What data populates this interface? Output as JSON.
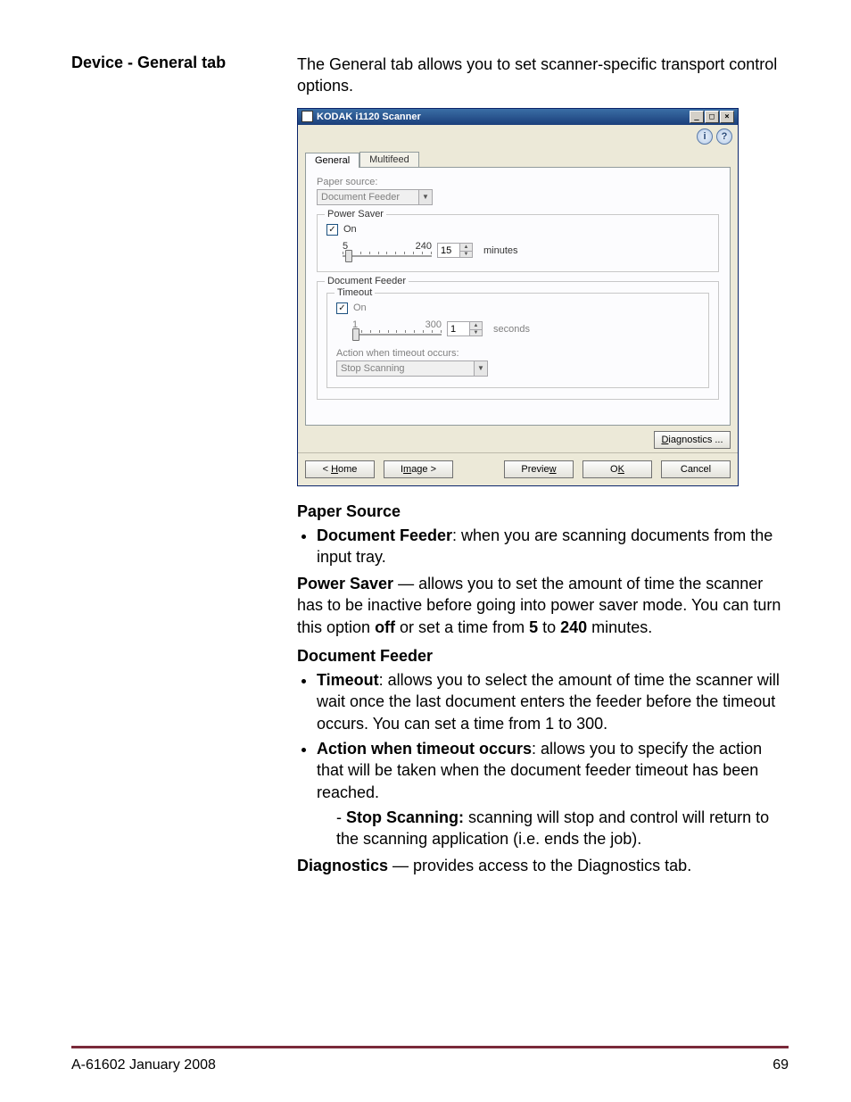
{
  "heading": "Device - General tab",
  "intro": "The General tab allows you to set scanner-specific transport control options.",
  "window": {
    "title": "KODAK i1120 Scanner",
    "tabs": {
      "general": "General",
      "multifeed": "Multifeed"
    },
    "paper_source": {
      "label": "Paper source:",
      "value": "Document Feeder"
    },
    "power_saver": {
      "group": "Power Saver",
      "on": "On",
      "min": "5",
      "max": "240",
      "value": "15",
      "unit": "minutes"
    },
    "doc_feeder": {
      "group": "Document Feeder",
      "timeout_group": "Timeout",
      "on": "On",
      "min": "1",
      "max": "300",
      "value": "1",
      "unit": "seconds",
      "action_label": "Action when timeout occurs:",
      "action_value": "Stop Scanning"
    },
    "buttons": {
      "diagnostics": "Diagnostics ...",
      "home": "< Home",
      "image": "Image >",
      "preview": "Preview",
      "ok": "OK",
      "cancel": "Cancel"
    }
  },
  "body": {
    "paper_source_h": "Paper Source",
    "doc_feed_bullet_label": "Document Feeder",
    "doc_feed_bullet_text": ": when you are scanning documents from the input tray.",
    "power_h": "Power Saver",
    "power_text_a": " — allows you to set the amount of time the scanner has to be inactive before going into power saver mode. You can turn this option ",
    "off": "off",
    "power_text_b": " or set a time from ",
    "five": "5",
    "to": " to ",
    "max": "240",
    "power_text_c": " minutes.",
    "doc_feed_h": "Document Feeder",
    "timeout_label": "Timeout",
    "timeout_text": ": allows you to select the amount of time the scanner will wait once the last document enters the feeder before the timeout occurs. You can set a time from 1 to 300.",
    "action_label": "Action when timeout occurs",
    "action_text": ": allows you to specify the action that will be taken when the document feeder timeout has been reached.",
    "stop_label": "Stop Scanning:",
    "stop_text": " scanning will stop and control will return to the scanning application (i.e. ends the job).",
    "diag_h": "Diagnostics",
    "diag_text": " — provides access to the Diagnostics tab."
  },
  "footer": {
    "left": "A-61602   January 2008",
    "right": "69"
  }
}
